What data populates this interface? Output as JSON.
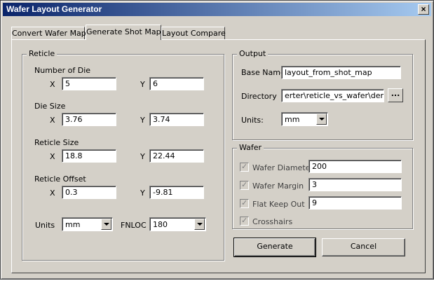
{
  "window": {
    "title": "Wafer Layout Generator",
    "close_glyph": "×"
  },
  "tabs": [
    {
      "label": "Convert Wafer Map"
    },
    {
      "label": "Generate Shot Map"
    },
    {
      "label": "Layout Compare"
    }
  ],
  "reticle": {
    "group_title": "Reticle",
    "number_of_die": {
      "label": "Number of Die",
      "x": "5",
      "y": "6"
    },
    "die_size": {
      "label": "Die Size",
      "x": "3.76",
      "y": "3.74"
    },
    "reticle_size": {
      "label": "Reticle Size",
      "x": "18.8",
      "y": "22.44"
    },
    "reticle_offset": {
      "label": "Reticle Offset",
      "x": "0.3",
      "y": "-9.81"
    },
    "x_label": "X",
    "y_label": "Y",
    "units_label": "Units",
    "units_value": "mm",
    "fnloc_label": "FNLOC",
    "fnloc_value": "180"
  },
  "output": {
    "group_title": "Output",
    "base_name_label": "Base Name",
    "base_name_value": "layout_from_shot_map",
    "directory_label": "Directory",
    "directory_value": "erter\\reticle_vs_wafer\\demo",
    "browse_label": "...",
    "units_label": "Units:",
    "units_value": "mm"
  },
  "wafer": {
    "group_title": "Wafer",
    "diameter_label": "Wafer Diameter",
    "diameter_value": "200",
    "margin_label": "Wafer Margin",
    "margin_value": "3",
    "flat_keep_out_label": "Flat Keep Out",
    "flat_keep_out_value": "9",
    "crosshairs_label": "Crosshairs"
  },
  "actions": {
    "generate_label": "Generate",
    "cancel_label": "Cancel"
  }
}
